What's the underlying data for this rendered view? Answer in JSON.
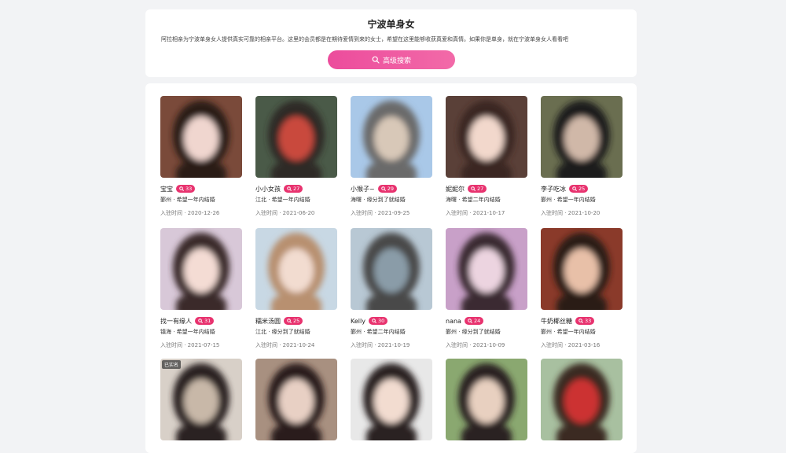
{
  "header": {
    "title": "宁波单身女",
    "intro": "阿拉相亲为宁波单身女人提供真实可靠的相亲平台。这里的会员都是在期待爱情到来的女士，希望在这里能够收获真爱和真情。如果你是单身，就在宁波单身女人看看吧",
    "search_label": "高级搜索"
  },
  "profiles": [
    {
      "name": "宝宝",
      "likes": "33",
      "desc": "鄞州 · 希望一年内结婚",
      "joined": "入驻时间 · 2020-12-26",
      "colors": [
        "#7a4a3a",
        "#f0d6cf",
        "#2b1c18"
      ],
      "verified": ""
    },
    {
      "name": "小小女孩",
      "likes": "27",
      "desc": "江北 · 希望一年内结婚",
      "joined": "入驻时间 · 2021-06-20",
      "colors": [
        "#4a5a48",
        "#c94a3c",
        "#2d2a26"
      ],
      "verified": ""
    },
    {
      "name": "小猴子~",
      "likes": "29",
      "desc": "海曙 · 缘分到了就结婚",
      "joined": "入驻时间 · 2021-09-25",
      "colors": [
        "#a9c8e8",
        "#d8c8b8",
        "#6a6a6a"
      ],
      "verified": ""
    },
    {
      "name": "妮妮尔",
      "likes": "27",
      "desc": "海曙 · 希望二年内结婚",
      "joined": "入驻时间 · 2021-10-17",
      "colors": [
        "#5a4038",
        "#f2d8cc",
        "#3a2620"
      ],
      "verified": ""
    },
    {
      "name": "李子吃冰",
      "likes": "25",
      "desc": "鄞州 · 希望一年内结婚",
      "joined": "入驻时间 · 2021-10-20",
      "colors": [
        "#6a6e50",
        "#d0b8a8",
        "#1e1c1a"
      ],
      "verified": ""
    },
    {
      "name": "找一有缘人",
      "likes": "31",
      "desc": "镇海 · 希望一年内结婚",
      "joined": "入驻时间 · 2021-07-15",
      "colors": [
        "#d8c8d8",
        "#f4dcd4",
        "#3a2a2a"
      ],
      "verified": ""
    },
    {
      "name": "糯米汤圆",
      "likes": "25",
      "desc": "江北 · 缘分到了就结婚",
      "joined": "入驻时间 · 2021-10-24",
      "colors": [
        "#c8d8e4",
        "#f2dcd0",
        "#b89070"
      ],
      "verified": ""
    },
    {
      "name": "Kelly",
      "likes": "30",
      "desc": "鄞州 · 希望二年内结婚",
      "joined": "入驻时间 · 2021-10-19",
      "colors": [
        "#b8c8d4",
        "#8a9ca8",
        "#4a4a48"
      ],
      "verified": ""
    },
    {
      "name": "nana",
      "likes": "24",
      "desc": "鄞州 · 缘分到了就结婚",
      "joined": "入驻时间 · 2021-10-09",
      "colors": [
        "#c8a0c8",
        "#ecd4e0",
        "#3a2a30"
      ],
      "verified": ""
    },
    {
      "name": "牛奶椰丝糖",
      "likes": "33",
      "desc": "鄞州 · 希望一年内结婚",
      "joined": "入驻时间 · 2021-03-16",
      "colors": [
        "#8a3a2a",
        "#e8c0a8",
        "#2a1a14"
      ],
      "verified": ""
    },
    {
      "name": "",
      "likes": "",
      "desc": "",
      "joined": "",
      "colors": [
        "#d8d0c8",
        "#c8b8a8",
        "#2a2422"
      ],
      "verified": "已实名"
    },
    {
      "name": "",
      "likes": "",
      "desc": "",
      "joined": "",
      "colors": [
        "#a89080",
        "#e8d0c4",
        "#2a1e1a"
      ],
      "verified": ""
    },
    {
      "name": "",
      "likes": "",
      "desc": "",
      "joined": "",
      "colors": [
        "#e8e8e8",
        "#f2dcd0",
        "#2a2422"
      ],
      "verified": ""
    },
    {
      "name": "",
      "likes": "",
      "desc": "",
      "joined": "",
      "colors": [
        "#8aa870",
        "#e8d0c0",
        "#2a2220"
      ],
      "verified": ""
    },
    {
      "name": "",
      "likes": "",
      "desc": "",
      "joined": "",
      "colors": [
        "#a8c0a0",
        "#cc3030",
        "#3a2a24"
      ],
      "verified": ""
    }
  ]
}
